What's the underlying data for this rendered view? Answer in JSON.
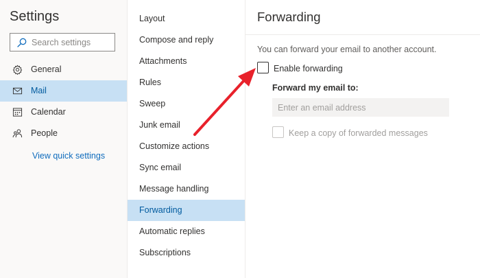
{
  "settings": {
    "title": "Settings",
    "search_placeholder": "Search settings"
  },
  "categories": [
    {
      "label": "General",
      "icon": "gear-icon",
      "selected": false
    },
    {
      "label": "Mail",
      "icon": "mail-icon",
      "selected": true
    },
    {
      "label": "Calendar",
      "icon": "calendar-icon",
      "selected": false
    },
    {
      "label": "People",
      "icon": "people-icon",
      "selected": false
    }
  ],
  "quick_settings_link": "View quick settings",
  "mail_sections": [
    {
      "label": "Layout",
      "selected": false
    },
    {
      "label": "Compose and reply",
      "selected": false
    },
    {
      "label": "Attachments",
      "selected": false
    },
    {
      "label": "Rules",
      "selected": false
    },
    {
      "label": "Sweep",
      "selected": false
    },
    {
      "label": "Junk email",
      "selected": false
    },
    {
      "label": "Customize actions",
      "selected": false
    },
    {
      "label": "Sync email",
      "selected": false
    },
    {
      "label": "Message handling",
      "selected": false
    },
    {
      "label": "Forwarding",
      "selected": true
    },
    {
      "label": "Automatic replies",
      "selected": false
    },
    {
      "label": "Subscriptions",
      "selected": false
    }
  ],
  "forwarding": {
    "title": "Forwarding",
    "description": "You can forward your email to another account.",
    "enable_label": "Enable forwarding",
    "enable_checked": false,
    "forward_to_label": "Forward my email to:",
    "email_placeholder": "Enter an email address",
    "email_value": "",
    "keep_copy_label": "Keep a copy of forwarded messages",
    "keep_copy_checked": false,
    "keep_copy_disabled": true
  },
  "colors": {
    "selected_bg": "#c7e0f4",
    "selected_text": "#005a9e",
    "link": "#0f6cbd",
    "annotation_arrow": "#e8212b"
  }
}
